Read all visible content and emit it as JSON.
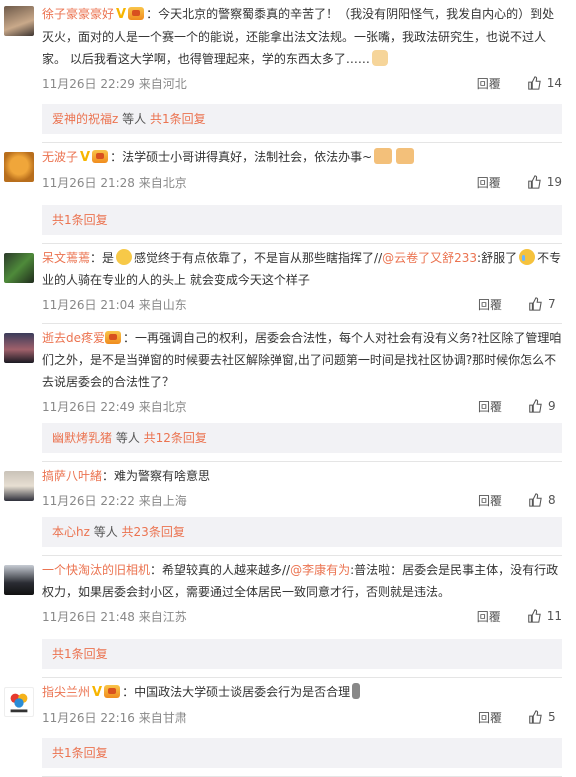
{
  "comments": [
    {
      "user": "徐子豪豪豪好",
      "text": "：今天北京的警察蜀黍真的辛苦了！（我没有阴阳怪气，我发自内心的）到处灭火，面对的人是一个赛一个的能说，还能拿出法文法规。一张嘴，我政法研究生，也说不过人家。 以后我看这大学啊，也得管理起来，学的东西太多了……",
      "time": "11月26日 22:29 来自河北",
      "reply": "回覆",
      "likes": "14",
      "sub_user": "爱神的祝福z",
      "sub_text": " 等人 ",
      "sub_more": "共1条回复"
    },
    {
      "user": "无波子",
      "text": "：法学硕士小哥讲得真好，法制社会，依法办事~",
      "time": "11月26日 21:28 来自北京",
      "reply": "回覆",
      "likes": "19",
      "sub_more": "共1条回复"
    },
    {
      "user": "呆文蔫蔫",
      "text_a": "：是",
      "text_b": "感觉终于有点依靠了，不是盲从那些瞎指挥了//",
      "mention": "@云卷了又舒233",
      "text_c": ":舒服了",
      "text_d": "不专业的人骑在专业的人的头上 就会变成今天这个样子",
      "time": "11月26日 21:04 来自山东",
      "reply": "回覆",
      "likes": "7"
    },
    {
      "user": "逝去de疼爱",
      "text": "：一再强调自己的权利，居委会合法性，每个人对社会有没有义务?社区除了管理咱们之外，是不是当弹窗的时候要去社区解除弹窗,出了问题第一时间是找社区协调?那时候你怎么不去说居委会的合法性了？",
      "time": "11月26日 22:49 来自北京",
      "reply": "回覆",
      "likes": "9",
      "sub_user": "幽默烤乳猪",
      "sub_text": " 等人 ",
      "sub_more": "共12条回复"
    },
    {
      "user": "搞萨八叶緒",
      "text": "：难为警察有啥意思",
      "time": "11月26日 22:22 来自上海",
      "reply": "回覆",
      "likes": "8",
      "sub_user": "本心hz",
      "sub_text": " 等人 ",
      "sub_more": "共23条回复"
    },
    {
      "user": "一个快淘汰的旧相机",
      "text_a": "：希望较真的人越来越多//",
      "mention": "@李康有为",
      "text_b": ":普法啦：居委会是民事主体，没有行政权力，如果居委会封小区，需要通过全体居民一致同意才行，否则就是违法。",
      "time": "11月26日 21:48 来自江苏",
      "reply": "回覆",
      "likes": "11",
      "sub_more": "共1条回复"
    },
    {
      "user": "指尖兰州",
      "text": "：中国政法大学硕士谈居委会行为是否合理",
      "time": "11月26日 22:16 来自甘肃",
      "reply": "回覆",
      "likes": "5",
      "sub_more": "共1条回复"
    }
  ],
  "colors": {
    "accent": "#eb7350",
    "muted": "#888888",
    "subbg": "#f2f2f5"
  }
}
